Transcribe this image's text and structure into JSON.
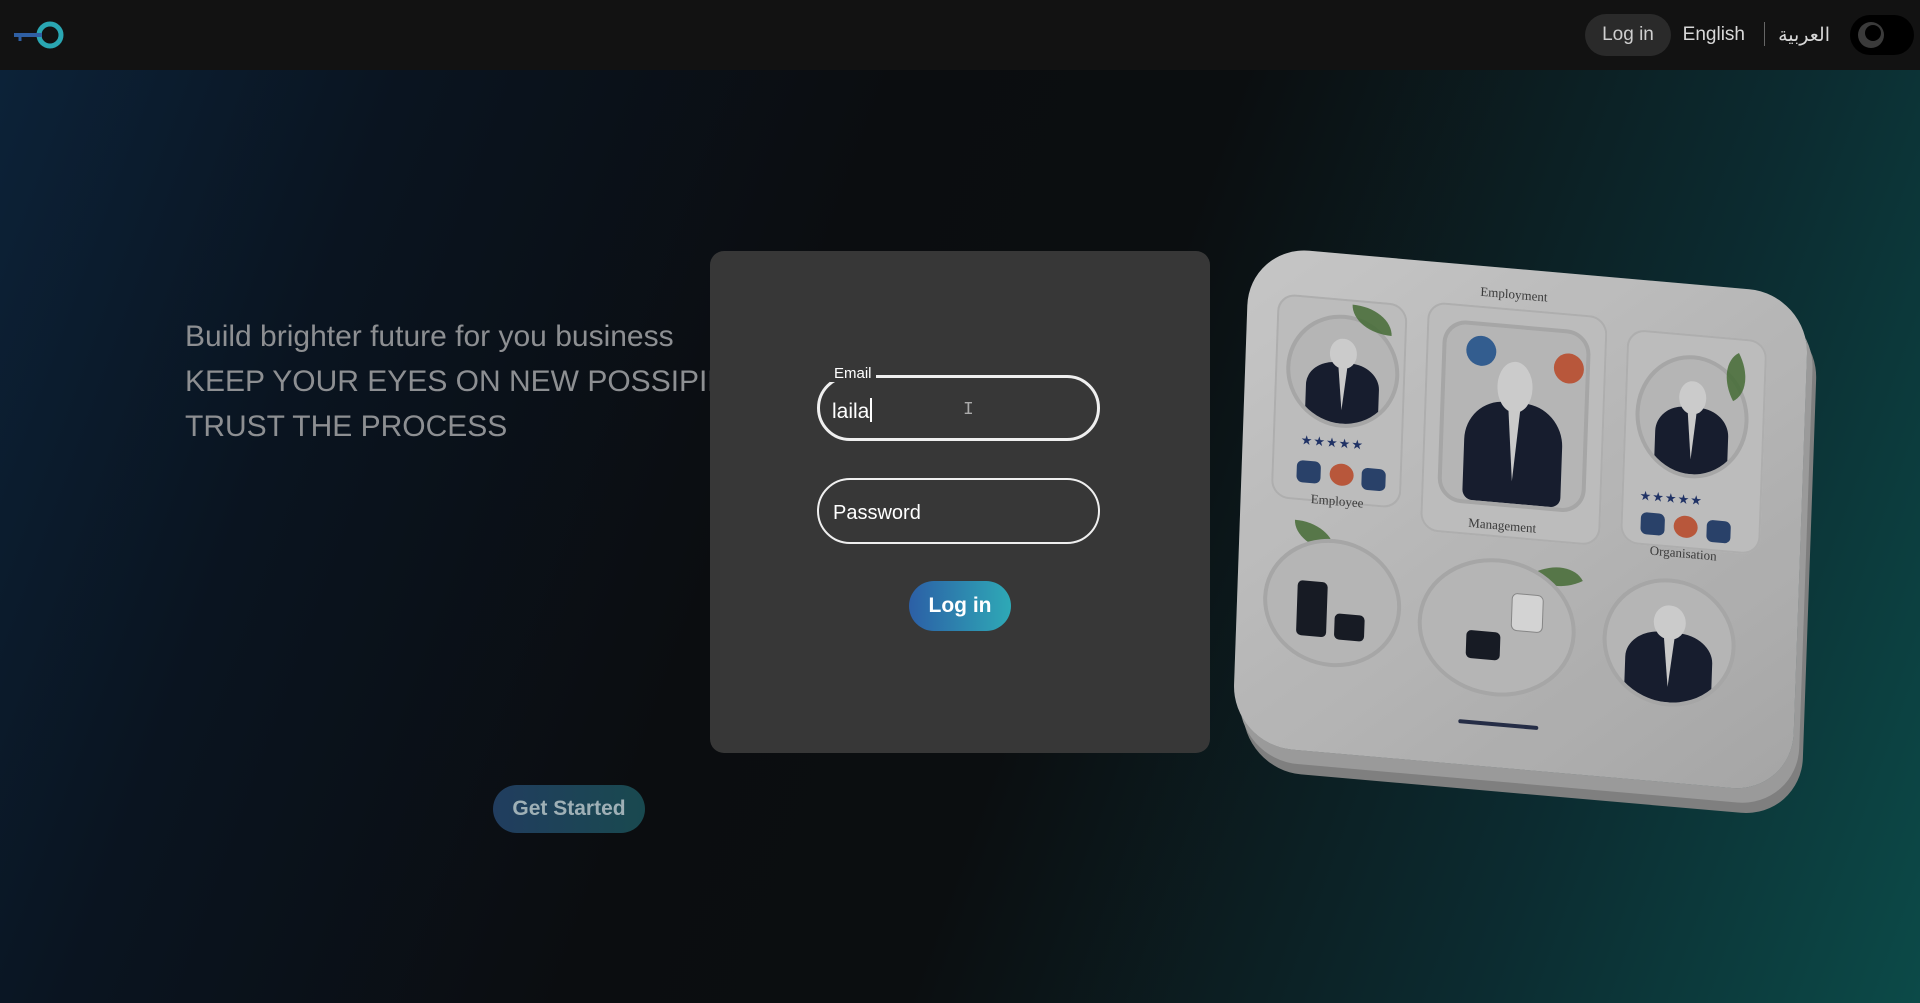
{
  "header": {
    "login_label": "Log in",
    "lang_english": "English",
    "lang_arabic": "العربية",
    "theme_icon": "moon-icon",
    "logo_icon": "key-logo-icon"
  },
  "hero": {
    "lines": [
      "Build brighter future for you business",
      "KEEP YOUR EYES ON NEW POSSIPILITIES",
      "TRUST THE PROCESS"
    ],
    "get_started_label": "Get Started"
  },
  "login_form": {
    "email_label": "Email",
    "email_value": "laila",
    "password_placeholder": "Password",
    "submit_label": "Log in"
  },
  "illustration": {
    "labels": [
      "Employment",
      "Employee",
      "Management",
      "Organisation"
    ]
  },
  "colors": {
    "accent_gradient_start": "#2c5fa6",
    "accent_gradient_end": "#2ea9b6",
    "card_bg": "#373737"
  }
}
